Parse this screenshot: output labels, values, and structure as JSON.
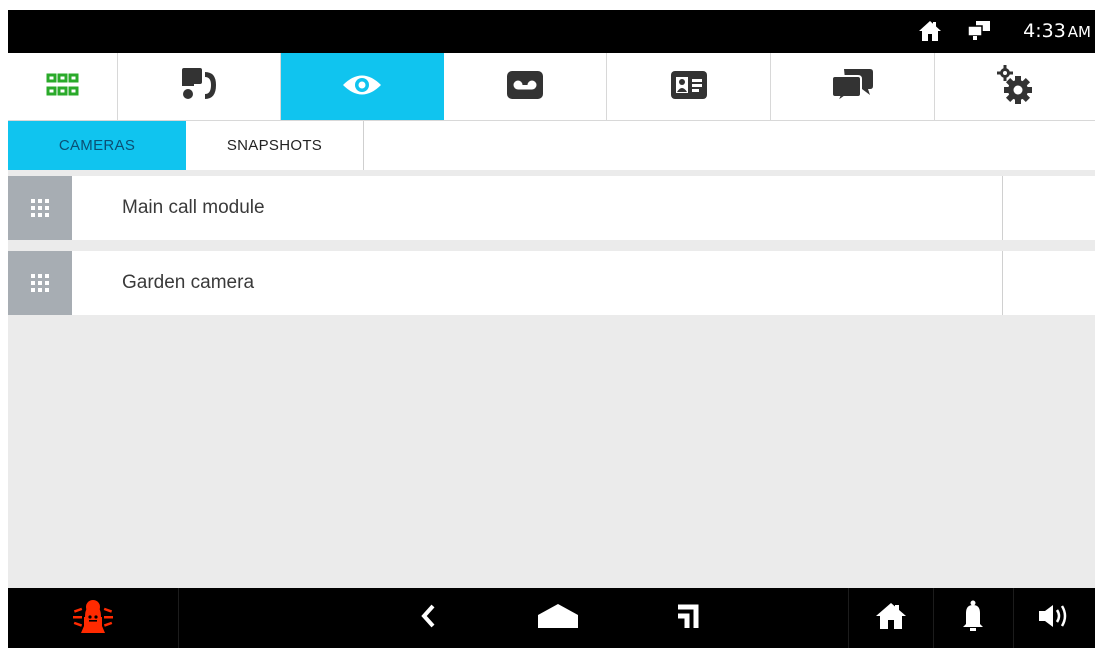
{
  "status_bar": {
    "time": "4:33",
    "ampm": "AM",
    "icons": [
      "home-icon",
      "network-icon"
    ]
  },
  "top_tabs": [
    {
      "icon": "apps-grid-icon",
      "active": false
    },
    {
      "icon": "intercom-icon",
      "active": false
    },
    {
      "icon": "eye-icon",
      "active": true
    },
    {
      "icon": "voicemail-icon",
      "active": false
    },
    {
      "icon": "contact-card-icon",
      "active": false
    },
    {
      "icon": "chat-bubbles-icon",
      "active": false
    },
    {
      "icon": "settings-gears-icon",
      "active": false
    }
  ],
  "sub_tabs": {
    "cameras": "CAMERAS",
    "snapshots": "SNAPSHOTS"
  },
  "cameras": [
    {
      "name": "Main call module"
    },
    {
      "name": "Garden camera"
    }
  ],
  "bottom_nav": {
    "icons": [
      "alarm-icon",
      "back-icon",
      "home-button-icon",
      "recent-apps-icon",
      "home-icon",
      "bell-icon",
      "volume-icon"
    ]
  },
  "colors": {
    "accent": "#10c4ef",
    "grid_green": "#2aaa2a",
    "alarm_red": "#ff2a00",
    "row_grip": "#a7adb3"
  }
}
